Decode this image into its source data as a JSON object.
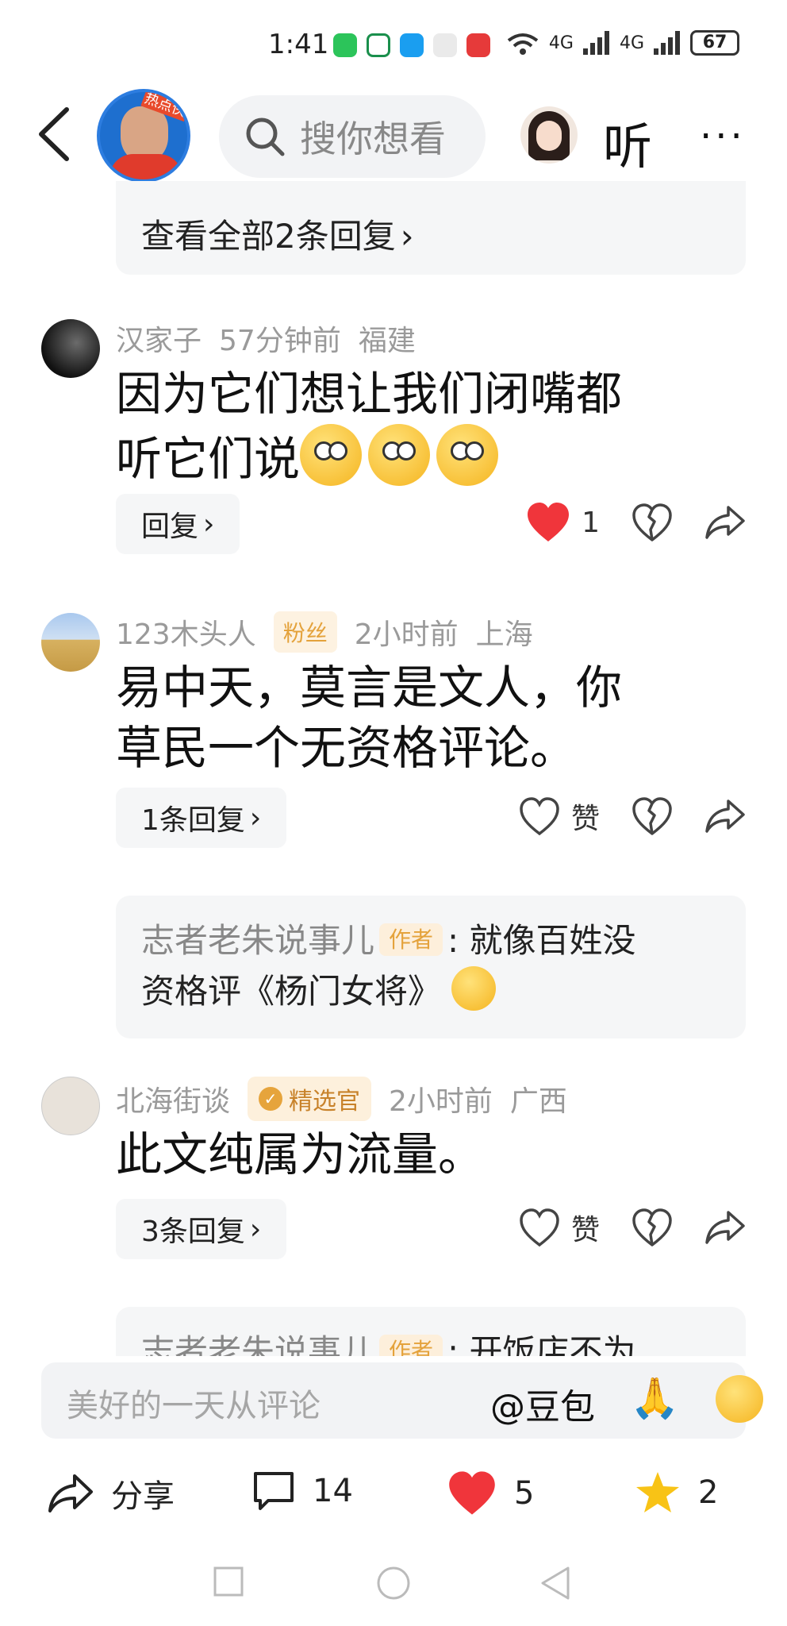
{
  "status_bar": {
    "time": "1:41",
    "battery": "67",
    "network": "4G"
  },
  "header": {
    "search_placeholder": "搜你想看",
    "listen_label": "听",
    "more_label": "···",
    "avatar_badge": "热点侠"
  },
  "thread_top": {
    "view_all_label": "查看全部2条回复"
  },
  "comments": [
    {
      "user": "汉家子",
      "time": "57分钟前",
      "location": "福建",
      "text_line1": "因为它们想让我们闭嘴都",
      "text_line2": "听它们说",
      "reply_label": "回复",
      "likes": "1"
    },
    {
      "user": "123木头人",
      "badge": "粉丝",
      "time": "2小时前",
      "location": "上海",
      "text_line1": "易中天，莫言是文人，你",
      "text_line2": "草民一个无资格评论。",
      "reply_label": "1条回复",
      "like_label": "赞",
      "sub_reply": {
        "author": "志者老朱说事儿",
        "author_badge": "作者",
        "text_line1": ": 就像百姓没",
        "text_line2": "资格评《杨门女将》"
      }
    },
    {
      "user": "北海街谈",
      "badge": "精选官",
      "time": "2小时前",
      "location": "广西",
      "text": "此文纯属为流量。",
      "reply_label": "3条回复",
      "like_label": "赞",
      "sub_reply": {
        "author": "志者老朱说事儿",
        "author_badge": "作者",
        "text": ": 开饭店不为"
      }
    }
  ],
  "input_bar": {
    "placeholder": "美好的一天从评论",
    "mention": "@豆包"
  },
  "bottom_bar": {
    "share_label": "分享",
    "comments_count": "14",
    "likes_count": "5",
    "favorites_count": "2"
  },
  "colors": {
    "heart_red": "#f0353b",
    "star_yellow": "#f8c316",
    "badge_orange": "#e4a23b"
  }
}
